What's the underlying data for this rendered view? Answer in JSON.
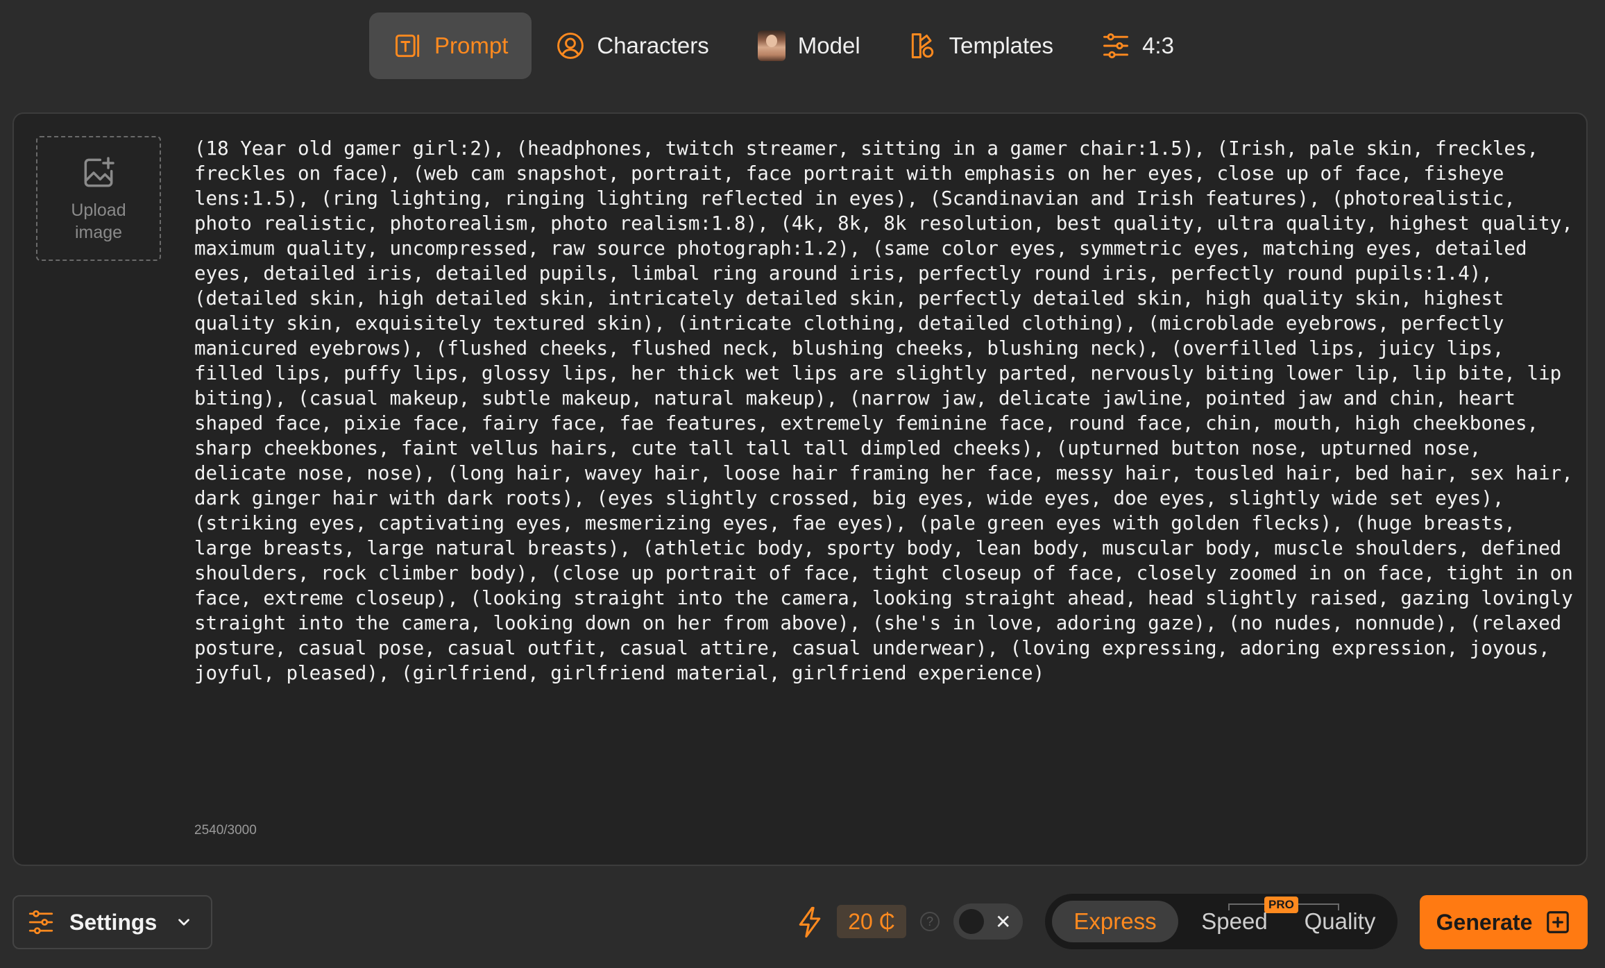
{
  "tabs": [
    {
      "label": "Prompt",
      "icon": "prompt-text-icon",
      "active": true
    },
    {
      "label": "Characters",
      "icon": "character-icon",
      "active": false
    },
    {
      "label": "Model",
      "icon": "model-avatar-icon",
      "active": false
    },
    {
      "label": "Templates",
      "icon": "templates-icon",
      "active": false
    },
    {
      "label": "4:3",
      "icon": "sliders-icon",
      "active": false
    }
  ],
  "upload": {
    "label_line1": "Upload",
    "label_line2": "image"
  },
  "prompt": {
    "text": "(18 Year old gamer girl:2), (headphones, twitch streamer, sitting in a gamer chair:1.5), (Irish, pale skin, freckles, freckles on face), (web cam snapshot, portrait, face portrait with emphasis on her eyes, close up of face, fisheye lens:1.5), (ring lighting, ringing lighting reflected in eyes), (Scandinavian and Irish features), (photorealistic, photo realistic, photorealism, photo realism:1.8), (4k, 8k, 8k resolution, best quality, ultra quality, highest quality, maximum quality, uncompressed, raw source photograph:1.2), (same color eyes, symmetric eyes, matching eyes, detailed eyes, detailed iris, detailed pupils, limbal ring around iris, perfectly round iris, perfectly round pupils:1.4), (detailed skin, high detailed skin, intricately detailed skin, perfectly detailed skin, high quality skin, highest quality skin, exquisitely textured skin), (intricate clothing, detailed clothing), (microblade eyebrows, perfectly manicured eyebrows), (flushed cheeks, flushed neck, blushing cheeks, blushing neck), (overfilled lips, juicy lips, filled lips, puffy lips, glossy lips, her thick wet lips are slightly parted, nervously biting lower lip, lip bite, lip biting), (casual makeup, subtle makeup, natural makeup), (narrow jaw, delicate jawline, pointed jaw and chin, heart shaped face, pixie face, fairy face, fae features, extremely feminine face, round face, chin, mouth, high cheekbones, sharp cheekbones, faint vellus hairs, cute tall tall tall dimpled cheeks), (upturned button nose, upturned nose, delicate nose, nose), (long hair, wavey hair, loose hair framing her face, messy hair, tousled hair, bed hair, sex hair, dark ginger hair with dark roots), (eyes slightly crossed, big eyes, wide eyes, doe eyes, slightly wide set eyes), (striking eyes, captivating eyes, mesmerizing eyes, fae eyes), (pale green eyes with golden flecks), (huge breasts, large breasts, large natural breasts), (athletic body, sporty body, lean body, muscular body, muscle shoulders, defined shoulders, rock climber body), (close up portrait of face, tight closeup of face, closely zoomed in on face, tight in on face, extreme closeup), (looking straight into the camera, looking straight ahead, head slightly raised, gazing lovingly straight into the camera, looking down on her from above), (she's in love, adoring gaze), (no nudes, nonnude), (relaxed posture, casual pose, casual outfit, casual attire, casual underwear), (loving expressing, adoring expression, joyous, joyful, pleased), (girlfriend, girlfriend material, girlfriend experience)",
    "counter": "2540/3000"
  },
  "settings": {
    "label": "Settings"
  },
  "credits": {
    "value": "20 ₵",
    "help": "?"
  },
  "modes": {
    "express": "Express",
    "speed": "Speed",
    "quality": "Quality",
    "pro_badge": "PRO",
    "selected": "Express"
  },
  "generate": {
    "label": "Generate"
  },
  "colors": {
    "accent": "#ff8a1f",
    "background": "#2c2c2c",
    "panel": "#232323"
  }
}
